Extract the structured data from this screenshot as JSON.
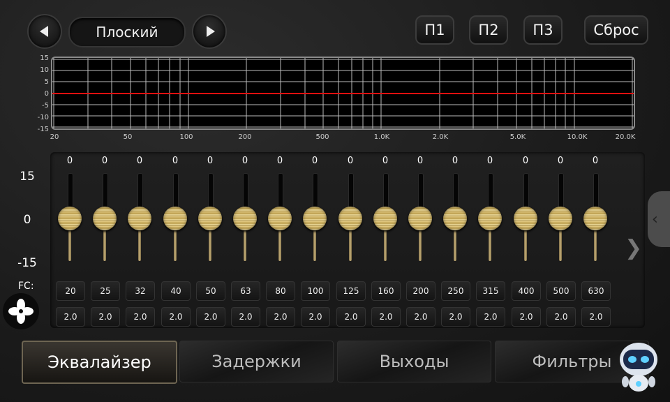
{
  "header": {
    "preset_name": "Плоский",
    "prev_icon": "chevron-left-icon",
    "next_icon": "chevron-right-icon",
    "presets": [
      "П1",
      "П2",
      "П3"
    ],
    "reset_label": "Сброс"
  },
  "graph": {
    "y_ticks": [
      "15",
      "10",
      "5",
      "0",
      "-5",
      "-10",
      "-15"
    ],
    "x_ticks": [
      "20",
      "50",
      "100",
      "200",
      "500",
      "1.0K",
      "2.0K",
      "5.0K",
      "10.0K",
      "20.0K"
    ],
    "curve_color": "#e01010",
    "grid_color": "#bdbdbd"
  },
  "sliders": {
    "scale_top": "15",
    "scale_mid": "0",
    "scale_bottom": "-15",
    "fc_label": "FC:",
    "bands": [
      {
        "gain": "0",
        "freq": "20",
        "q": "2.0"
      },
      {
        "gain": "0",
        "freq": "25",
        "q": "2.0"
      },
      {
        "gain": "0",
        "freq": "32",
        "q": "2.0"
      },
      {
        "gain": "0",
        "freq": "40",
        "q": "2.0"
      },
      {
        "gain": "0",
        "freq": "50",
        "q": "2.0"
      },
      {
        "gain": "0",
        "freq": "63",
        "q": "2.0"
      },
      {
        "gain": "0",
        "freq": "80",
        "q": "2.0"
      },
      {
        "gain": "0",
        "freq": "100",
        "q": "2.0"
      },
      {
        "gain": "0",
        "freq": "125",
        "q": "2.0"
      },
      {
        "gain": "0",
        "freq": "160",
        "q": "2.0"
      },
      {
        "gain": "0",
        "freq": "200",
        "q": "2.0"
      },
      {
        "gain": "0",
        "freq": "250",
        "q": "2.0"
      },
      {
        "gain": "0",
        "freq": "315",
        "q": "2.0"
      },
      {
        "gain": "0",
        "freq": "400",
        "q": "2.0"
      },
      {
        "gain": "0",
        "freq": "500",
        "q": "2.0"
      },
      {
        "gain": "0",
        "freq": "630",
        "q": "2.0"
      }
    ]
  },
  "tabs": [
    {
      "label": "Эквалайзер",
      "active": true
    },
    {
      "label": "Задержки",
      "active": false
    },
    {
      "label": "Выходы",
      "active": false
    },
    {
      "label": "Фильтры",
      "active": false
    }
  ],
  "icons": {
    "fan": "fan-icon",
    "more": "chevron-right-icon",
    "side_drawer": "chevron-left-icon",
    "assistant": "robot-icon"
  },
  "colors": {
    "accent_gold": "#c9a955",
    "active_tab_border": "#6e6552"
  }
}
